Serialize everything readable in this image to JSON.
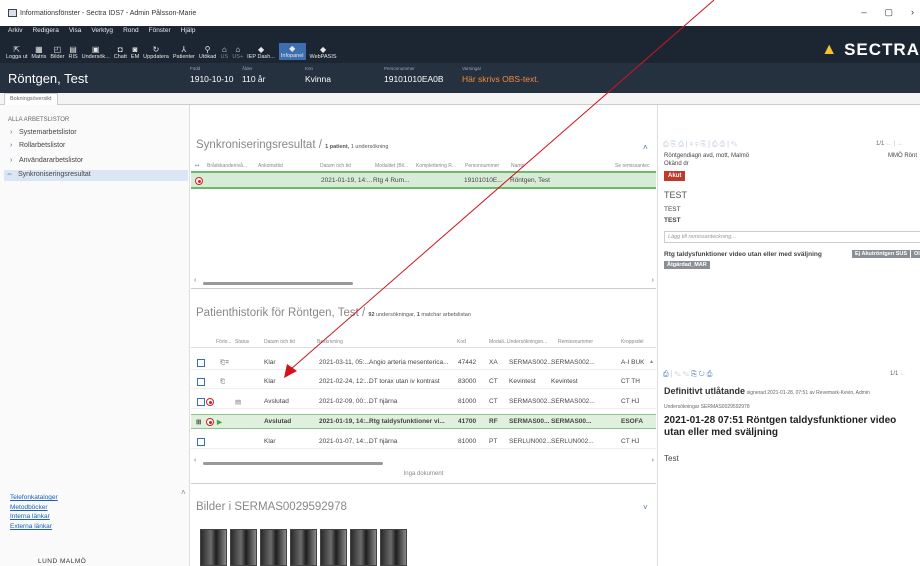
{
  "window": {
    "title": "Informationsfönster - Sectra IDS7 - Admin Pålsson-Marie",
    "controls": [
      "–",
      "▢",
      "›"
    ]
  },
  "menu": [
    "Arkiv",
    "Redigera",
    "Visa",
    "Verktyg",
    "Rond",
    "Fönster",
    "Hjälp"
  ],
  "toolbar": [
    {
      "label": "Logga ut",
      "icon": "logout-icon"
    },
    {
      "label": "Matris",
      "icon": "matrix-icon"
    },
    {
      "label": "Bilder",
      "icon": "images-icon"
    },
    {
      "label": "RIS",
      "icon": "ris-icon"
    },
    {
      "label": "Undersök...",
      "icon": "examine-icon"
    },
    {
      "label": "Chatt",
      "icon": "chat-icon"
    },
    {
      "label": "EM",
      "icon": "em-icon"
    },
    {
      "label": "Uppdatera",
      "icon": "refresh-icon"
    },
    {
      "label": "Patienter",
      "icon": "patients-icon"
    },
    {
      "label": "Utökad",
      "icon": "extended-icon"
    },
    {
      "label": "US",
      "icon": "us-icon"
    },
    {
      "label": "US+",
      "icon": "us-plus-icon"
    },
    {
      "label": "IEP Dash...",
      "icon": "iep-icon"
    },
    {
      "label": "Infopanel",
      "icon": "infopanel-icon"
    },
    {
      "label": "WebPASIS",
      "icon": "webpasis-icon"
    }
  ],
  "brand": "SECTRA",
  "patient": {
    "name": "Röntgen, Test",
    "fields": [
      {
        "label": "Född",
        "value": "1910-10-10"
      },
      {
        "label": "Ålder",
        "value": "110 år"
      },
      {
        "label": "Kön",
        "value": "Kvinna"
      },
      {
        "label": "Personnummer",
        "value": "19101010EA0B"
      },
      {
        "label": "Varningar",
        "value": "Här skrivs OBS-text."
      }
    ]
  },
  "subtab": "Bokningsöversikt",
  "sidebar": {
    "heading": "ALLA ARBETSLISTOR",
    "items": [
      "Systemarbetslistor",
      "Rollarbetslistor",
      "Användararbetslistor",
      "Synkroniseringsresultat"
    ],
    "links": [
      "Telefonkataloger",
      "Metodböcker",
      "Interna länkar",
      "Externa länkar"
    ],
    "logo_text": "LUND MALMÖ"
  },
  "sync": {
    "title": "Synkroniseringsresultat /",
    "count_patients": "1 patient,",
    "count_exams": "1 undersökning",
    "columns": [
      "Brådskandenivå...",
      "Ankomsttid",
      "Datum och tid",
      "Modalitet (Bil...",
      "Komplettering R...",
      "Personnummer",
      "Namn",
      "Se remissantec"
    ],
    "rows": [
      {
        "datetime": "2021-01-19, 14:...",
        "room": "Rtg 4 Rum...",
        "pnr": "19101010E...",
        "name": "Röntgen, Test"
      }
    ]
  },
  "history": {
    "title": "Patienthistorik för Röntgen, Test /",
    "count": "92",
    "count_label": "undersökningar,",
    "match": "1",
    "match_label": "matchar arbetslistan",
    "columns": [
      "Förlo...",
      "Status",
      "Datum och tid",
      "Beskrivning",
      "Kod",
      "Modali...",
      "Undersökningsn...",
      "Remissnummer",
      "Kroppsdel"
    ],
    "rows": [
      {
        "status": "Klar",
        "datetime": "2021-03-11, 05:...",
        "desc": "Angio arteria mesenterica...",
        "code": "47442",
        "mod": "XA",
        "exam": "SERMAS002...",
        "remiss": "SERMAS002...",
        "body": "A-I BUK"
      },
      {
        "status": "Klar",
        "datetime": "2021-02-24, 12:...",
        "desc": "DT torax utan iv kontrast",
        "code": "83000",
        "mod": "CT",
        "exam": "Kevintest",
        "remiss": "Kevintest",
        "body": "CT TH"
      },
      {
        "status": "Avslutad",
        "datetime": "2021-02-09, 00:...",
        "desc": "DT hjärna",
        "code": "81000",
        "mod": "CT",
        "exam": "SERMAS002...",
        "remiss": "SERMAS002...",
        "body": "CT HJ"
      },
      {
        "status": "Avslutad",
        "datetime": "2021-01-19, 14:...",
        "desc": "Rtg taldysfunktioner vi...",
        "code": "41700",
        "mod": "RF",
        "exam": "SERMAS00...",
        "remiss": "SERMAS00...",
        "body": "ESOFA"
      },
      {
        "status": "Klar",
        "datetime": "2021-01-07, 14:...",
        "desc": "DT hjärna",
        "code": "81000",
        "mod": "PT",
        "exam": "SERLUN002...",
        "remiss": "SERLUN002...",
        "body": "CT HJ"
      }
    ],
    "footer": "Inga dokument"
  },
  "images": {
    "title": "Bilder i SERMAS0029592978"
  },
  "remiss": {
    "pager": "1/1",
    "dept": "Röntgendiagn avd, mott, Malmö",
    "dept_right": "MMÖ Rönt",
    "doctor": "Okänd dr",
    "priority": "Akut",
    "text1": "TEST",
    "text2": "TEST",
    "text3": "TEST",
    "note_placeholder": "Lägg till remissanteckning...",
    "exam": "Rtg taldysfunktioner video utan eller med sväljning",
    "tags": [
      "Ej Akutröntgen SUS",
      "Ol",
      "Åtgärdad_MAR"
    ]
  },
  "report": {
    "pager": "1/1",
    "title": "Definitivt utlåtande",
    "signed": "signerad 2021-01-28, 07:51 av Revemark-Kevin, Admin",
    "exams": "Undersökningar SERMAS0029592978",
    "heading": "2021-01-28 07:51 Röntgen taldysfunktioner video utan eller med sväljning",
    "body": "Test"
  },
  "annotation": {
    "color": "#d0141e"
  }
}
